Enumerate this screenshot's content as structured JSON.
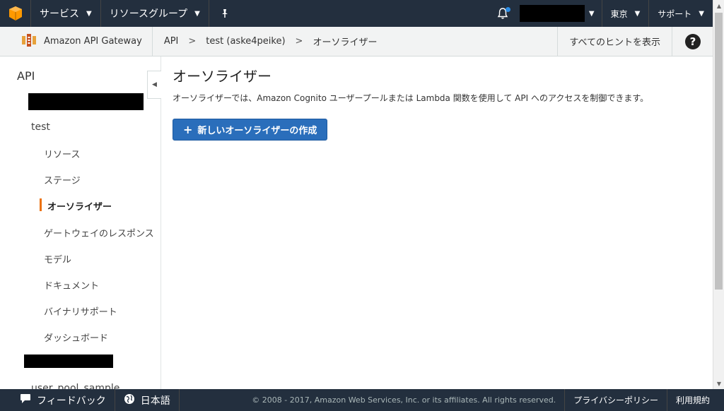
{
  "topnav": {
    "services_label": "サービス",
    "resource_groups_label": "リソースグループ",
    "region_label": "東京",
    "support_label": "サポート"
  },
  "subbar": {
    "service_name": "Amazon API Gateway",
    "crumb_api": "API",
    "crumb_api_name": "test (aske4peike)",
    "crumb_page": "オーソライザー",
    "hints_label": "すべてのヒントを表示",
    "help_glyph": "?"
  },
  "sidebar": {
    "title": "API",
    "api_name": "test",
    "items": [
      {
        "label": "リソース"
      },
      {
        "label": "ステージ"
      },
      {
        "label": "オーソライザー"
      },
      {
        "label": "ゲートウェイのレスポンス"
      },
      {
        "label": "モデル"
      },
      {
        "label": "ドキュメント"
      },
      {
        "label": "バイナリサポート"
      },
      {
        "label": "ダッシュボード"
      }
    ],
    "partial_item": "user_pool_sample"
  },
  "main": {
    "title": "オーソライザー",
    "description": "オーソライザーでは、Amazon Cognito ユーザープールまたは Lambda 関数を使用して API へのアクセスを制御できます。",
    "create_button": "新しいオーソライザーの作成"
  },
  "footer": {
    "feedback_label": "フィードバック",
    "language_label": "日本語",
    "copyright": "© 2008 - 2017, Amazon Web Services, Inc. or its affiliates. All rights reserved.",
    "privacy_label": "プライバシーポリシー",
    "terms_label": "利用規約"
  },
  "colors": {
    "nav_bg": "#232f3e",
    "primary_button": "#2a6ebb",
    "active_accent": "#ec7211",
    "notification_dot": "#2b8de6"
  }
}
